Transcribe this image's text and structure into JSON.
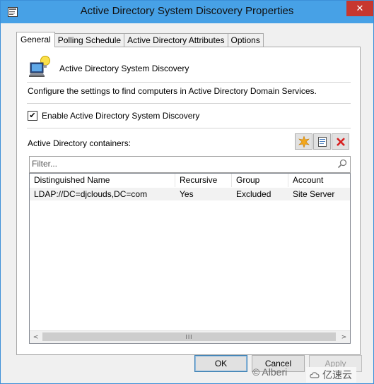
{
  "window": {
    "title": "Active Directory System Discovery Properties",
    "close_glyph": "✕"
  },
  "tabs": [
    {
      "label": "General",
      "active": true
    },
    {
      "label": "Polling Schedule",
      "active": false
    },
    {
      "label": "Active Directory Attributes",
      "active": false
    },
    {
      "label": "Options",
      "active": false
    }
  ],
  "general": {
    "heading": "Active Directory System Discovery",
    "description": "Configure the settings to find computers in Active Directory Domain Services.",
    "enable_label": "Enable Active Directory System Discovery",
    "enable_checked": true,
    "check_glyph": "✔",
    "containers_label": "Active Directory containers:",
    "filter_placeholder": "Filter..."
  },
  "toolbar": {
    "new_icon": "starburst-icon",
    "properties_icon": "properties-icon",
    "delete_icon": "delete-x-icon"
  },
  "table": {
    "columns": [
      "Distinguished Name",
      "Recursive",
      "Group",
      "Account"
    ],
    "rows": [
      [
        "LDAP://DC=djclouds,DC=com",
        "Yes",
        "Excluded",
        "Site Server"
      ]
    ]
  },
  "scrollbar": {
    "left_glyph": "<",
    "right_glyph": ">",
    "thumb_glyph": "III"
  },
  "buttons": {
    "ok": "OK",
    "cancel": "Cancel",
    "apply": "Apply"
  },
  "watermark": {
    "text": "© Alberi",
    "logo_text": "亿速云"
  },
  "colors": {
    "titlebar": "#47a1e6",
    "close": "#c7372f",
    "delete_red": "#d81e1e",
    "star_orange": "#f4a81c"
  }
}
